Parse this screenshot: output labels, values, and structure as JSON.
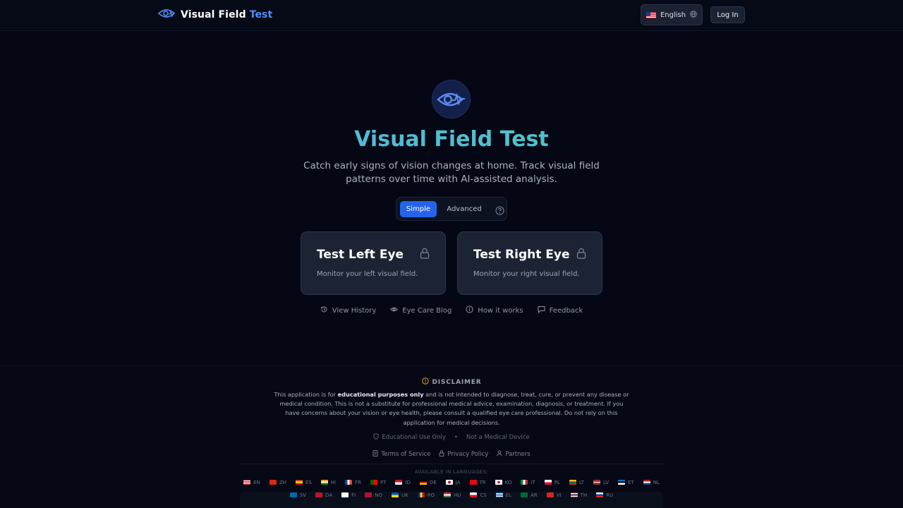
{
  "header": {
    "brand_main": "Visual Field",
    "brand_accent": "Test",
    "language": "English",
    "login": "Log In"
  },
  "hero": {
    "title": "Visual Field Test",
    "subtitle": "Catch early signs of vision changes at home. Track visual field patterns over time with AI-assisted analysis."
  },
  "mode": {
    "simple": "Simple",
    "advanced": "Advanced",
    "selected": "Simple"
  },
  "cards": [
    {
      "title": "Test Left Eye",
      "desc": "Monitor your left visual field."
    },
    {
      "title": "Test Right Eye",
      "desc": "Monitor your right visual field."
    }
  ],
  "links": [
    "View History",
    "Eye Care Blog",
    "How it works",
    "Feedback"
  ],
  "footer": {
    "disclaimer_title": "DISCLAIMER",
    "disclaimer_pre": "This application is for ",
    "disclaimer_bold": "educational purposes only",
    "disclaimer_post": " and is not intended to diagnose, treat, cure, or prevent any disease or medical condition. This is not a substitute for professional medical advice, examination, diagnosis, or treatment. If you have concerns about your vision or eye health, please consult a qualified eye care professional. Do not rely on this application for medical decisions.",
    "badge_edu": "Educational Use Only",
    "badge_sep": "•",
    "badge_device": "Not a Medical Device",
    "terms": "Terms of Service",
    "privacy": "Privacy Policy",
    "partners": "Partners",
    "available": "AVAILABLE IN LANGUAGES:"
  },
  "languages": [
    "EN",
    "ZH",
    "ES",
    "HI",
    "FR",
    "PT",
    "ID",
    "DE",
    "JA",
    "TR",
    "KO",
    "IT",
    "PL",
    "LT",
    "LV",
    "ET",
    "NL",
    "SV",
    "DA",
    "FI",
    "NO",
    "UK",
    "RO",
    "HU",
    "CS",
    "EL",
    "AR",
    "VI",
    "TH",
    "RU"
  ],
  "colors": {
    "accent": "#2563eb",
    "brand_accent": "#4f8ef7",
    "background": "#050814",
    "card": "#1c2434",
    "disclaimer_icon": "#e0a43a"
  }
}
